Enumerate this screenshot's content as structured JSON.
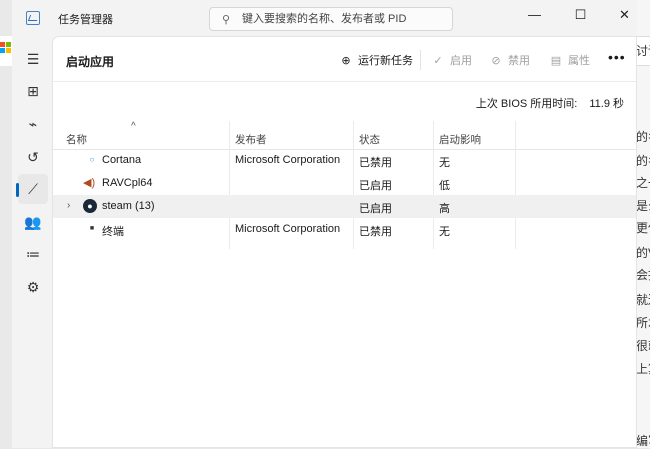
{
  "window": {
    "title": "任务管理器"
  },
  "search": {
    "placeholder": "键入要搜索的名称、发布者或 PID"
  },
  "window_controls": {
    "minimize": "—",
    "maximize": "☐",
    "close": "✕"
  },
  "sidebar": {
    "items": [
      {
        "name": "menu",
        "icon": "☰"
      },
      {
        "name": "processes",
        "icon": "⊞"
      },
      {
        "name": "performance",
        "icon": "⌁"
      },
      {
        "name": "app-history",
        "icon": "↺"
      },
      {
        "name": "startup-apps",
        "icon": "⟋",
        "active": true
      },
      {
        "name": "users",
        "icon": "👥"
      },
      {
        "name": "details",
        "icon": "≔"
      },
      {
        "name": "services",
        "icon": "⚙"
      }
    ]
  },
  "page": {
    "title": "启动应用"
  },
  "toolbar": {
    "run_new_task": "运行新任务",
    "enable": "启用",
    "disable": "禁用",
    "properties": "属性",
    "more": "•••"
  },
  "bios": {
    "label": "上次 BIOS 所用时间:",
    "value": "11.9 秒"
  },
  "table": {
    "columns": [
      "名称",
      "发布者",
      "状态",
      "启动影响"
    ],
    "sort_indicator": "^",
    "rows": [
      {
        "name": "Cortana",
        "publisher": "Microsoft Corporation",
        "status": "已禁用",
        "impact": "无",
        "icon": "cortana-icon"
      },
      {
        "name": "RAVCpl64",
        "publisher": "",
        "status": "已启用",
        "impact": "低",
        "icon": "speaker-icon"
      },
      {
        "name": "steam (13)",
        "publisher": "",
        "status": "已启用",
        "impact": "高",
        "icon": "steam-icon",
        "expandable": true,
        "selected": true
      },
      {
        "name": "终端",
        "publisher": "Microsoft Corporation",
        "status": "已禁用",
        "impact": "无",
        "icon": "terminal-icon"
      }
    ]
  },
  "background": {
    "right_texts": [
      "讨论",
      "的名",
      "的名",
      "之一",
      "是么",
      "更但",
      "的V",
      "会指",
      "就送",
      "所才",
      "很就",
      "上算",
      "编写"
    ]
  }
}
